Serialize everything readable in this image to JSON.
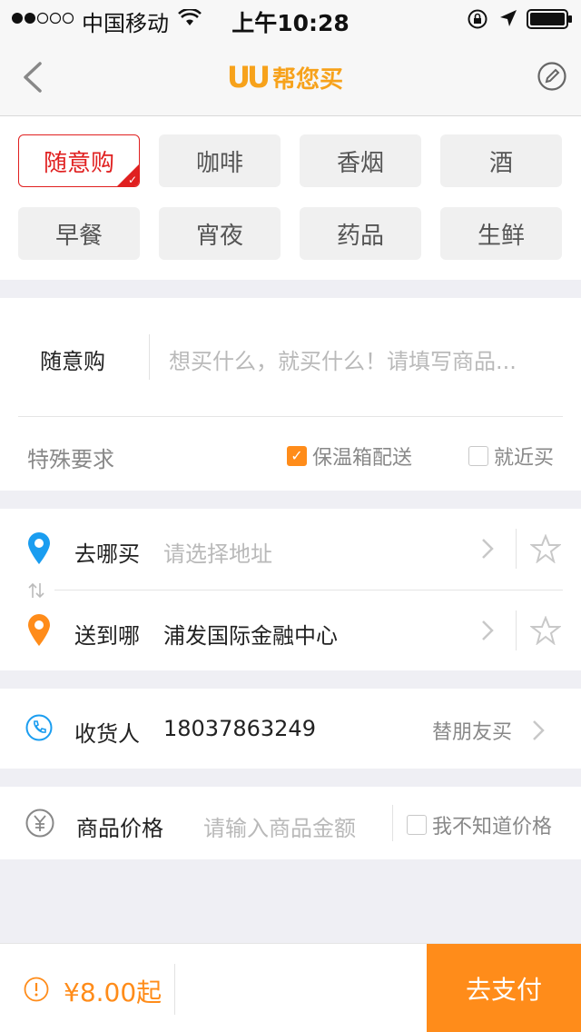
{
  "status_bar": {
    "carrier": "中国移动",
    "time": "上午10:28"
  },
  "nav": {
    "logo_mark": "UU",
    "logo_text": "帮您买"
  },
  "categories": [
    {
      "label": "随意购",
      "active": true
    },
    {
      "label": "咖啡",
      "active": false
    },
    {
      "label": "香烟",
      "active": false
    },
    {
      "label": "酒",
      "active": false
    },
    {
      "label": "早餐",
      "active": false
    },
    {
      "label": "宵夜",
      "active": false
    },
    {
      "label": "药品",
      "active": false
    },
    {
      "label": "生鲜",
      "active": false
    }
  ],
  "description": {
    "label": "随意购",
    "placeholder": "想买什么，就买什么！请填写商品...",
    "special_label": "特殊要求",
    "option_insulated": "保温箱配送",
    "option_nearby": "就近买"
  },
  "address": {
    "buy_label": "去哪买",
    "buy_placeholder": "请选择地址",
    "deliver_label": "送到哪",
    "deliver_value": "浦发国际金融中心"
  },
  "receiver": {
    "label": "收货人",
    "phone": "18037863249",
    "friend_link": "替朋友买"
  },
  "price": {
    "label": "商品价格",
    "placeholder": "请输入商品金额",
    "unknown_label": "我不知道价格"
  },
  "bottom": {
    "price": "¥8.00起",
    "pay_label": "去支付"
  },
  "colors": {
    "accent": "#ff8c1a",
    "active_red": "#e02020",
    "pin_blue": "#1a9df0",
    "pin_orange": "#ff8c1a"
  }
}
